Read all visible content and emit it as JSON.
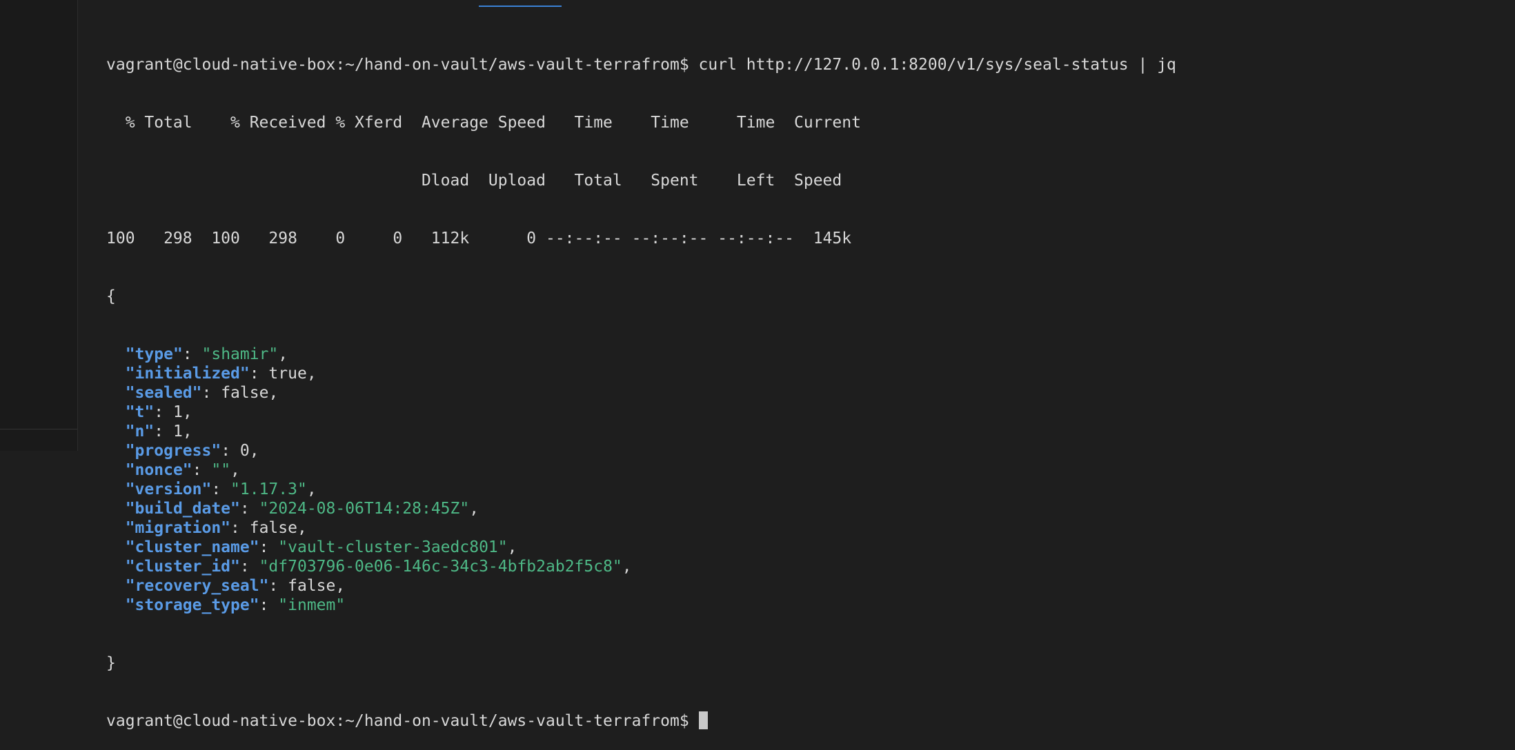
{
  "prompt": "vagrant@cloud-native-box:~/hand-on-vault/aws-vault-terrafrom$",
  "command": " curl http://127.0.0.1:8200/v1/sys/seal-status | jq",
  "curl_progress": {
    "header1": "  % Total    % Received % Xferd  Average Speed   Time    Time     Time  Current",
    "header2": "                                 Dload  Upload   Total   Spent    Left  Speed",
    "values": "100   298  100   298    0     0   112k      0 --:--:-- --:--:-- --:--:--  145k"
  },
  "json_open": "{",
  "json_close": "}",
  "json_fields": [
    {
      "key": "\"type\"",
      "value": "\"shamir\"",
      "vtype": "str",
      "comma": true
    },
    {
      "key": "\"initialized\"",
      "value": "true",
      "vtype": "lit",
      "comma": true
    },
    {
      "key": "\"sealed\"",
      "value": "false",
      "vtype": "lit",
      "comma": true
    },
    {
      "key": "\"t\"",
      "value": "1",
      "vtype": "lit",
      "comma": true
    },
    {
      "key": "\"n\"",
      "value": "1",
      "vtype": "lit",
      "comma": true
    },
    {
      "key": "\"progress\"",
      "value": "0",
      "vtype": "lit",
      "comma": true
    },
    {
      "key": "\"nonce\"",
      "value": "\"\"",
      "vtype": "str",
      "comma": true
    },
    {
      "key": "\"version\"",
      "value": "\"1.17.3\"",
      "vtype": "str",
      "comma": true
    },
    {
      "key": "\"build_date\"",
      "value": "\"2024-08-06T14:28:45Z\"",
      "vtype": "str",
      "comma": true
    },
    {
      "key": "\"migration\"",
      "value": "false",
      "vtype": "lit",
      "comma": true
    },
    {
      "key": "\"cluster_name\"",
      "value": "\"vault-cluster-3aedc801\"",
      "vtype": "str",
      "comma": true
    },
    {
      "key": "\"cluster_id\"",
      "value": "\"df703796-0e06-146c-34c3-4bfb2ab2f5c8\"",
      "vtype": "str",
      "comma": true
    },
    {
      "key": "\"recovery_seal\"",
      "value": "false",
      "vtype": "lit",
      "comma": true
    },
    {
      "key": "\"storage_type\"",
      "value": "\"inmem\"",
      "vtype": "str",
      "comma": false
    }
  ],
  "final_prompt": "vagrant@cloud-native-box:~/hand-on-vault/aws-vault-terrafrom$",
  "colors": {
    "background": "#1e1e1e",
    "json_key": "#5a9be6",
    "json_string": "#4eb886",
    "text": "#d8d8d8",
    "tab_accent": "#3b82d6"
  }
}
